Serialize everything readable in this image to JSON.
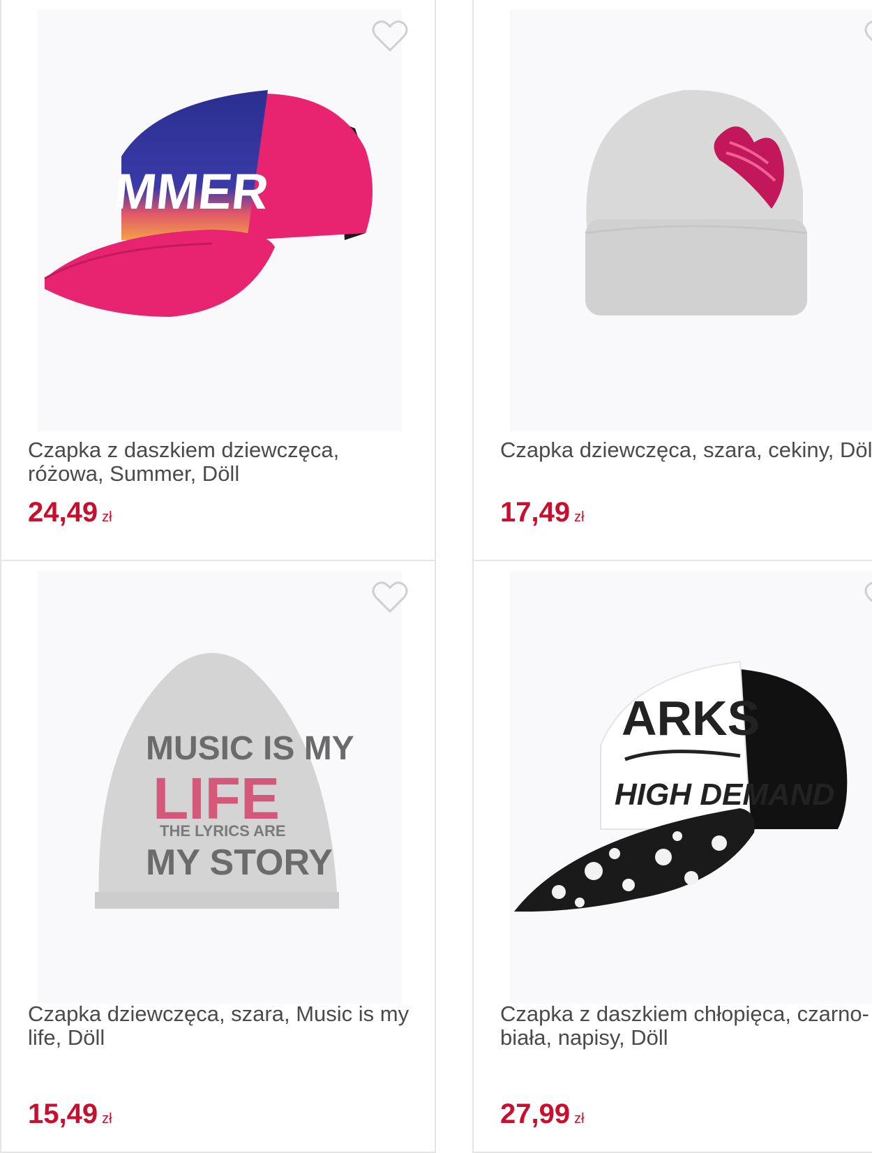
{
  "colors": {
    "price": "#c8102e",
    "title": "#4a4a4a",
    "card_border": "#e6e6e6"
  },
  "products": [
    {
      "title": "Czapka z daszkiem dziewczęca, różowa, Summer, Döll",
      "price": "24,49",
      "currency": "zł",
      "image_icon": "pink-summer-cap-image",
      "print_text": "MMER"
    },
    {
      "title": "Czapka dziewczęca, szara, cekiny, Döll",
      "price": "17,49",
      "currency": "zł",
      "image_icon": "grey-sequin-beanie-image"
    },
    {
      "title": "Czapka dziewczęca, szara, Music is my life, Döll",
      "price": "15,49",
      "currency": "zł",
      "image_icon": "grey-music-beanie-image",
      "print_line1": "MUSIC IS MY",
      "print_line2": "LIFE",
      "print_line3": "THE LYRICS ARE",
      "print_line4": "MY STORY"
    },
    {
      "title": "Czapka z daszkiem chłopięca, czarno-biała, napisy, Döll",
      "price": "27,99",
      "currency": "zł",
      "image_icon": "black-white-shark-cap-image",
      "print_line1": "ARKS",
      "print_line2": "HIGH DEMAND"
    }
  ]
}
